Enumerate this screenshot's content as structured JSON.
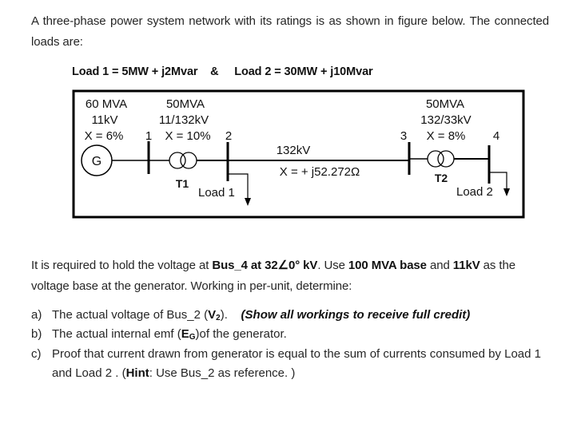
{
  "intro": "A three-phase power system network with its ratings is as shown in figure below. The connected loads are:",
  "loads_line": {
    "load1": "Load 1 = 5MW + j2Mvar",
    "separator": "&",
    "load2": "Load 2 = 30MW + j10Mvar"
  },
  "diagram": {
    "generator": {
      "symbol": "G",
      "rating": "60 MVA",
      "voltage": "11kV",
      "reactance": "X = 6%"
    },
    "t1": {
      "rating": "50MVA",
      "voltage": "11/132kV",
      "reactance": "X = 10%",
      "label": "T1"
    },
    "line": {
      "voltage": "132kV",
      "reactance": "X = + j52.272Ω"
    },
    "t2": {
      "rating": "50MVA",
      "voltage": "132/33kV",
      "reactance": "X = 8%",
      "label": "T2"
    },
    "buses": [
      "1",
      "2",
      "3",
      "4"
    ],
    "load1_label": "Load 1",
    "load2_label": "Load 2"
  },
  "requirement": {
    "p1": "It is required to hold the voltage at ",
    "bus4": "Bus_4 at 32∠0° kV",
    "p2": ". Use ",
    "base_mva": "100 MVA base",
    "p3": " and ",
    "base_kv": "11kV",
    "p4": " as the voltage base at the generator. Working in per-unit, determine:"
  },
  "questions": [
    {
      "label": "a)",
      "text": "The actual voltage of Bus_2 (",
      "sym": "V",
      "sub": "2",
      "after": ").",
      "note": "(Show all workings to receive full credit)"
    },
    {
      "label": "b)",
      "text": "The actual internal emf (",
      "sym": "E",
      "sub": "G",
      "after": ")of the generator."
    },
    {
      "label": "c)",
      "text": "Proof that current drawn from generator is equal to the sum of currents consumed by Load 1 and Load 2 .  (",
      "hint": "Hint",
      "after": ": Use Bus_2 as reference. )"
    }
  ]
}
